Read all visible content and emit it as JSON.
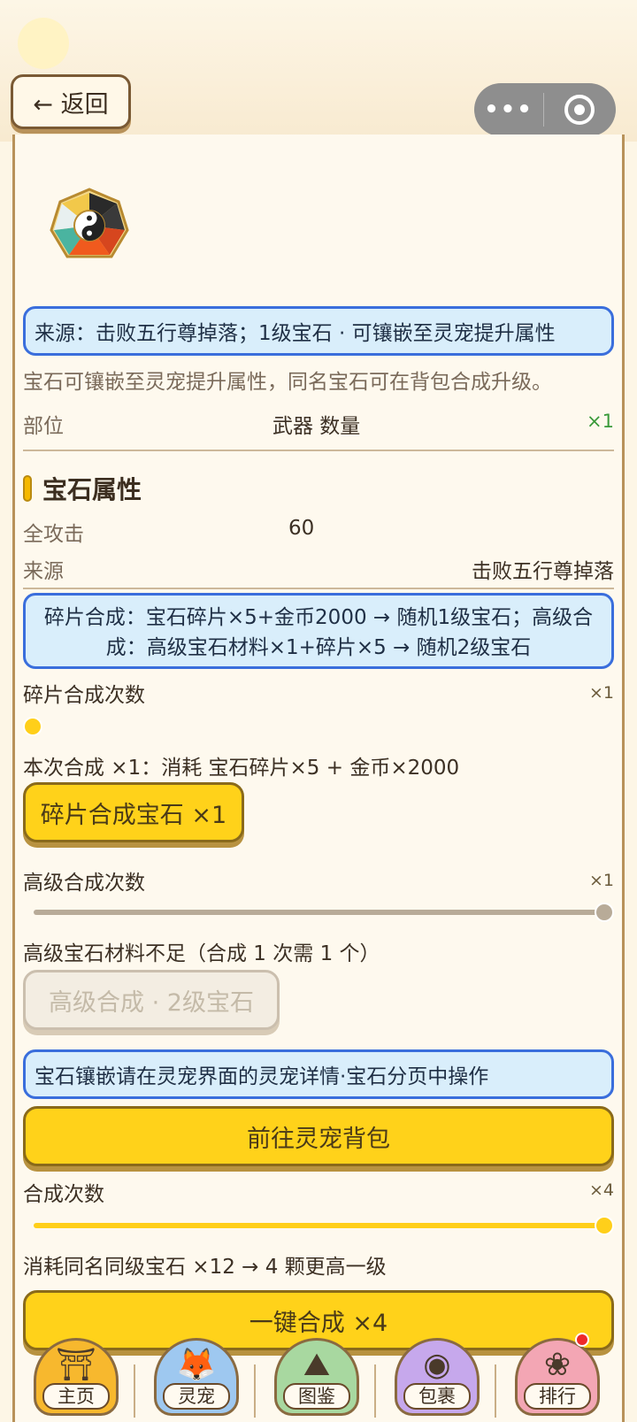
{
  "header": {
    "back_label": "← 返回",
    "capsule_more": "•••"
  },
  "item": {
    "icon": "bagua-gem-icon",
    "source_box": "来源：击败五行尊掉落；1级宝石 · 可镶嵌至灵宠提升属性",
    "description": "宝石可镶嵌至灵宠提升属性，同名宝石可在背包合成升级。",
    "slot_label": "部位",
    "slot_value": "武器 数量",
    "quantity": "×1"
  },
  "attributes": {
    "title": "宝石属性",
    "rows": [
      {
        "label": "全攻击",
        "value": "60"
      },
      {
        "label": "来源",
        "value": "击败五行尊掉落"
      }
    ]
  },
  "synthesis": {
    "recipe_box": "碎片合成：宝石碎片×5+金币2000 → 随机1级宝石；高级合成：高级宝石材料×1+碎片×5 → 随机2级宝石",
    "fragment_count_label": "碎片合成次数",
    "fragment_count_value": "×1",
    "fragment_cost": "本次合成 ×1：消耗 宝石碎片×5 + 金币×2000",
    "fragment_button": "碎片合成宝石 ×1",
    "advanced_count_label": "高级合成次数",
    "advanced_count_value": "×1",
    "advanced_slider_level": 1.0,
    "advanced_warning": "高级宝石材料不足（合成 1 次需 1 个）",
    "advanced_button": "高级合成 · 2级宝石"
  },
  "inlay": {
    "hint_box": "宝石镶嵌请在灵宠界面的灵宠详情·宝石分页中操作",
    "goto_button": "前往灵宠背包"
  },
  "merge": {
    "count_label": "合成次数",
    "count_value": "×4",
    "slider_level": 1.0,
    "cost_text": "消耗同名同级宝石 ×12 → 4 颗更高一级",
    "merge_button": "一键合成 ×4"
  },
  "tabs": [
    {
      "label": "主页",
      "icon": "pagoda-icon",
      "color": "#f7b82e"
    },
    {
      "label": "灵宠",
      "icon": "fox-pet-icon",
      "color": "#9ec8f0"
    },
    {
      "label": "图鉴",
      "icon": "mountain-icon",
      "color": "#a8d8a0"
    },
    {
      "label": "包裹",
      "icon": "bag-icon",
      "color": "#c6a8ec"
    },
    {
      "label": "排行",
      "icon": "flower-rank-icon",
      "color": "#f3a6b4"
    }
  ]
}
